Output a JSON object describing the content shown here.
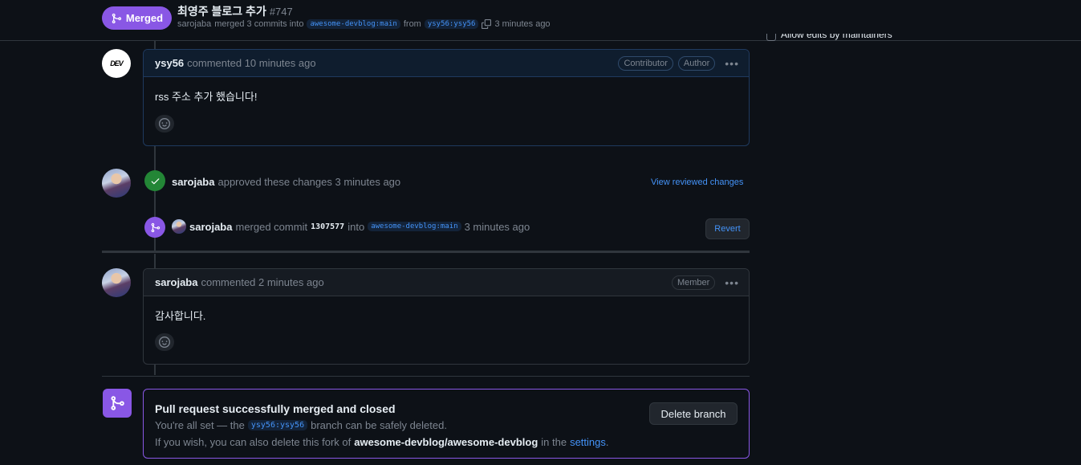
{
  "header": {
    "status_label": "Merged",
    "title": "최영주 블로그 추가",
    "pr_number": "#747",
    "sub_author": "sarojaba",
    "sub_text": "merged 3 commits into",
    "base_branch": "awesome-devblog:main",
    "from_text": "from",
    "head_branch": "ysy56:ysy56",
    "time": "3 minutes ago"
  },
  "sidebar_peek": {
    "text": "Allow edits by maintainers"
  },
  "comment1": {
    "author": "ysy56",
    "avatar_text": "DEV",
    "meta": "commented 10 minutes ago",
    "labels": [
      "Contributor",
      "Author"
    ],
    "body": "rss 주소 추가 했습니다!"
  },
  "review_event": {
    "user": "sarojaba",
    "text": "approved these changes 3 minutes ago",
    "link": "View reviewed changes"
  },
  "merge_event": {
    "user": "sarojaba",
    "text": "merged commit",
    "sha": "1307577",
    "into": "into",
    "branch": "awesome-devblog:main",
    "time": "3 minutes ago",
    "revert_label": "Revert"
  },
  "comment2": {
    "author": "sarojaba",
    "meta": "commented 2 minutes ago",
    "labels": [
      "Member"
    ],
    "body": "감사합니다."
  },
  "merged_box": {
    "title": "Pull request successfully merged and closed",
    "line1_pre": "You're all set — the",
    "line1_branch": "ysy56:ysy56",
    "line1_post": "branch can be safely deleted.",
    "line2_pre": "If you wish, you can also delete this fork of",
    "line2_repo": "awesome-devblog/awesome-devblog",
    "line2_mid": "in the",
    "line2_link": "settings",
    "line2_end": ".",
    "delete_label": "Delete branch"
  },
  "colors": {
    "merged_purple": "#8957e5",
    "approved_green": "#238636",
    "link_blue": "#4493f8"
  }
}
